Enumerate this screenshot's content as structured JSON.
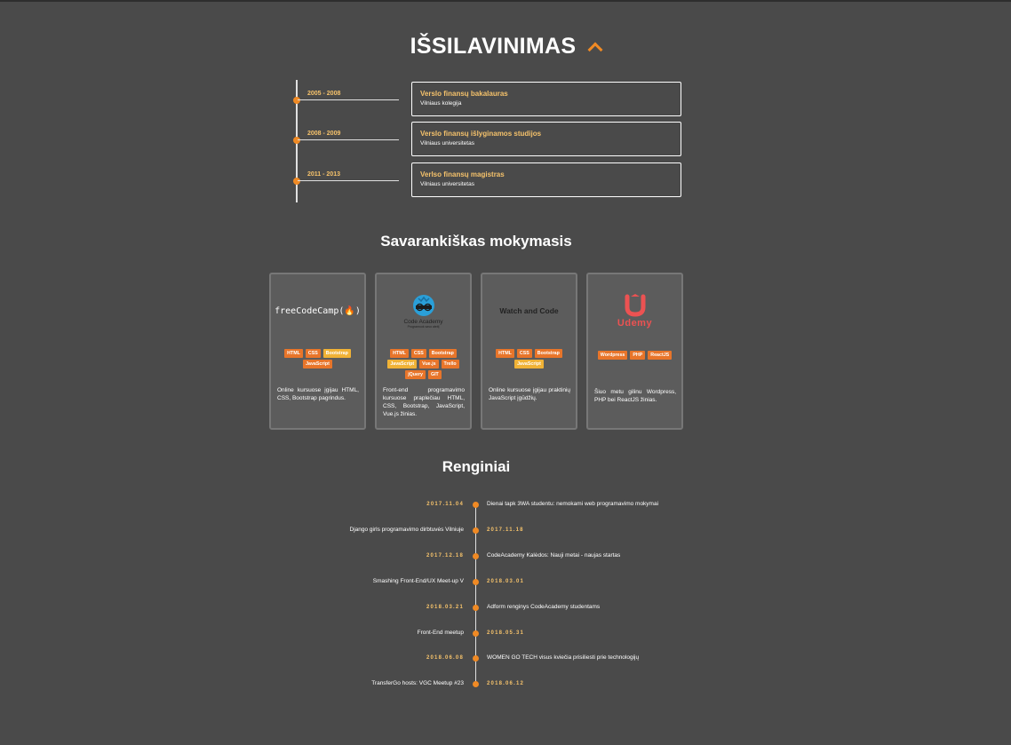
{
  "education": {
    "title": "IŠSILAVINIMAS",
    "items": [
      {
        "years": "2005 - 2008",
        "title": "Verslo finansų bakalauras",
        "school": "Vilniaus kolegija"
      },
      {
        "years": "2008 - 2009",
        "title": "Verslo finansų išlyginamos studijos",
        "school": "Vilniaus universitetas"
      },
      {
        "years": "2011 - 2013",
        "title": "Verlso finansų magistras",
        "school": "Vilniaus universitetas"
      }
    ]
  },
  "self_learning": {
    "title": "Savarankiškas mokymasis",
    "cards": [
      {
        "logo_text": "freeCodeCamp(🔥)",
        "tags": [
          "HTML",
          "CSS",
          "Bootstrap",
          "JavaScript"
        ],
        "description": "Online kursuose įgijau HTML, CSS, Bootstrap pagrindus."
      },
      {
        "logo_text": "Code Academy",
        "logo_sub": "Programuok savo ateitį",
        "tags": [
          "HTML",
          "CSS",
          "Bootstrap",
          "JavaScript",
          "Vue.js",
          "Trello",
          "jQuery",
          "GIT"
        ],
        "description": "Front-end programavimo kursuose praplečiau HTML, CSS, Bootstrap, JavaScript, Vue.js žinias."
      },
      {
        "logo_text": "Watch and Code",
        "tags": [
          "HTML",
          "CSS",
          "Bootstrap",
          "JavaScript"
        ],
        "description": "Online kursuose įgijau praktinių JavaScript įgūdžių."
      },
      {
        "logo_text": "Udemy",
        "tags": [
          "Wordpress",
          "PHP",
          "ReactJS"
        ],
        "description": "Šiuo metu gilinu Wordpress, PHP bei ReactJS žinias."
      }
    ]
  },
  "events": {
    "title": "Renginiai",
    "items": [
      {
        "date": "2017.11.04",
        "name": "Dienai tapk 3WA studentu: nemokami web programavimo mokymai"
      },
      {
        "date": "2017.11.18",
        "name": "Django girls programavimo dirbtuvės Vilniuje"
      },
      {
        "date": "2017.12.18",
        "name": "CodeAcademy Kalėdos: Nauji metai - naujas startas"
      },
      {
        "date": "2018.03.01",
        "name": "Smashing Front-End/UX Meet-up V"
      },
      {
        "date": "2018.03.21",
        "name": "Adform renginys CodeAcademy studentams"
      },
      {
        "date": "2018.05.31",
        "name": "Front-End meetup"
      },
      {
        "date": "2018.06.08",
        "name": "WOMEN GO TECH visus kviečia prisiliesti prie technologijų"
      },
      {
        "date": "2018.06.12",
        "name": "TransferGo hosts: VGC Meetup #23"
      }
    ]
  },
  "colors": {
    "accent": "#f08a24",
    "accent_light": "#f5c26b",
    "background": "#4a4a4a"
  },
  "icons": {
    "collapse": "chevron-up-icon"
  }
}
